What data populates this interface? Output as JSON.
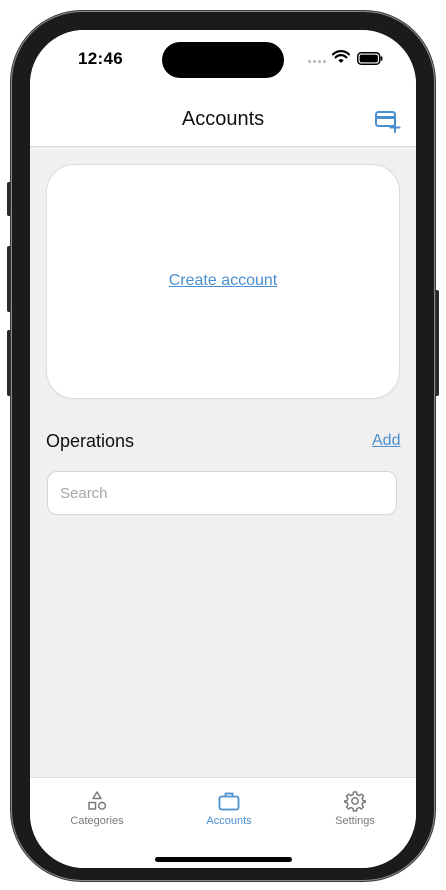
{
  "status_bar": {
    "time": "12:46",
    "wifi_icon": "wifi-icon",
    "battery_icon": "battery-icon"
  },
  "header": {
    "title": "Accounts",
    "add_account_icon": "credit-card-plus-icon"
  },
  "accounts_card": {
    "create_link": "Create account"
  },
  "operations": {
    "title": "Operations",
    "add_link": "Add",
    "search_placeholder": "Search",
    "search_value": ""
  },
  "tabs": [
    {
      "label": "Categories",
      "icon": "shapes-icon",
      "active": false
    },
    {
      "label": "Accounts",
      "icon": "briefcase-icon",
      "active": true
    },
    {
      "label": "Settings",
      "icon": "gear-icon",
      "active": false
    }
  ],
  "colors": {
    "accent": "#4a8fcf",
    "background": "#f0f0f0",
    "inactive_tab": "#7a7a7a"
  }
}
